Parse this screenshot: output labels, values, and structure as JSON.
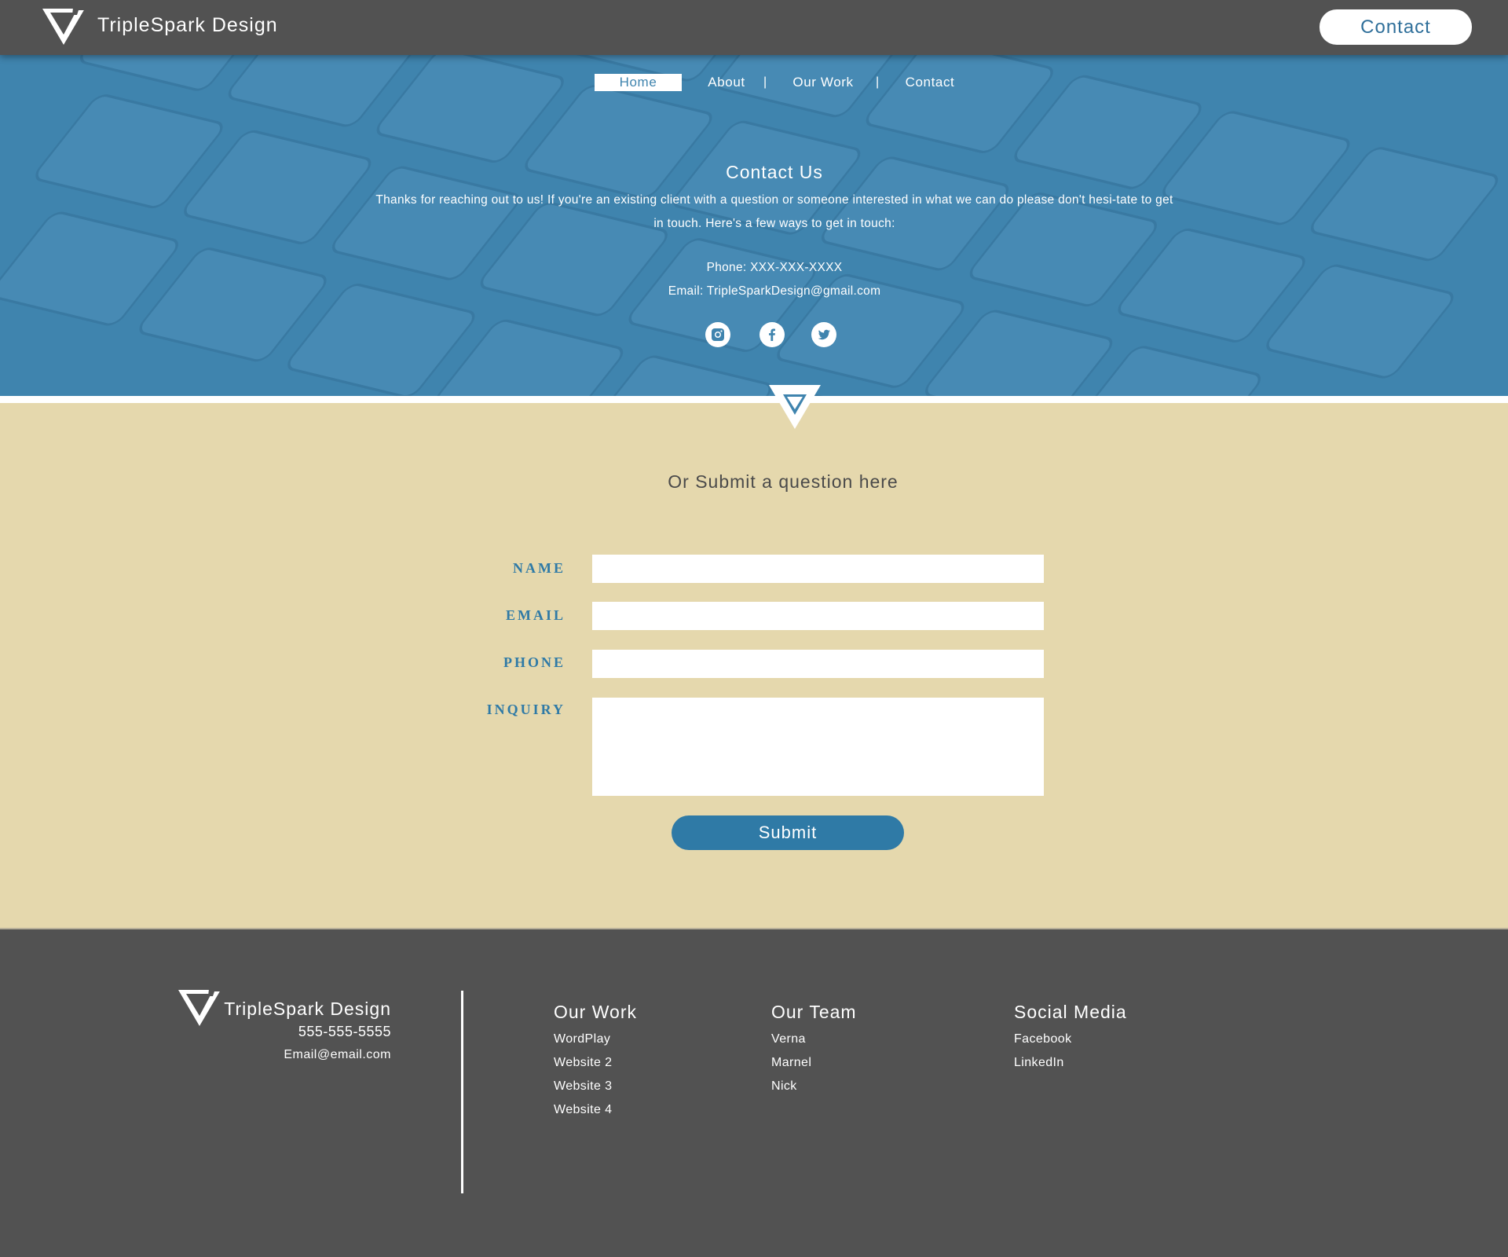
{
  "brand": {
    "name": "TripleSpark Design"
  },
  "header": {
    "contact_button": "Contact"
  },
  "nav": {
    "items": [
      "Home",
      "About",
      "Our Work",
      "Contact"
    ],
    "separator": "|"
  },
  "hero": {
    "title": "Contact Us",
    "text": "Thanks for reaching out to us! If you're an existing client with a question or someone interested in what we can do please don't hesi-tate to get in touch. Here's a few ways to get in touch:",
    "phone": "Phone: XXX-XXX-XXXX",
    "email": "Email: TripleSparkDesign@gmail.com",
    "social_icons": [
      "instagram-icon",
      "facebook-icon",
      "twitter-icon"
    ]
  },
  "form": {
    "heading": "Or Submit a question here",
    "name_label": "NAME",
    "email_label": "EMAIL",
    "phone_label": "PHONE",
    "inquiry_label": "INQUIRY",
    "name_value": "",
    "email_value": "",
    "phone_value": "",
    "inquiry_value": "",
    "submit": "Submit"
  },
  "footer": {
    "brand": "TripleSpark Design",
    "phone": "555-555-5555",
    "email": "Email@email.com",
    "columns": [
      {
        "title": "Our Work",
        "links": [
          "WordPlay",
          "Website 2",
          "Website 3",
          "Website 4"
        ]
      },
      {
        "title": "Our Team",
        "links": [
          "Verna",
          "Marnel",
          "Nick"
        ]
      },
      {
        "title": "Social Media",
        "links": [
          "Facebook",
          "LinkedIn"
        ]
      }
    ]
  },
  "colors": {
    "header_bg": "#525252",
    "hero_blue": "#3f84ae",
    "accent_blue": "#2f7aa6",
    "form_bg": "#e5d8ad",
    "white": "#ffffff"
  }
}
